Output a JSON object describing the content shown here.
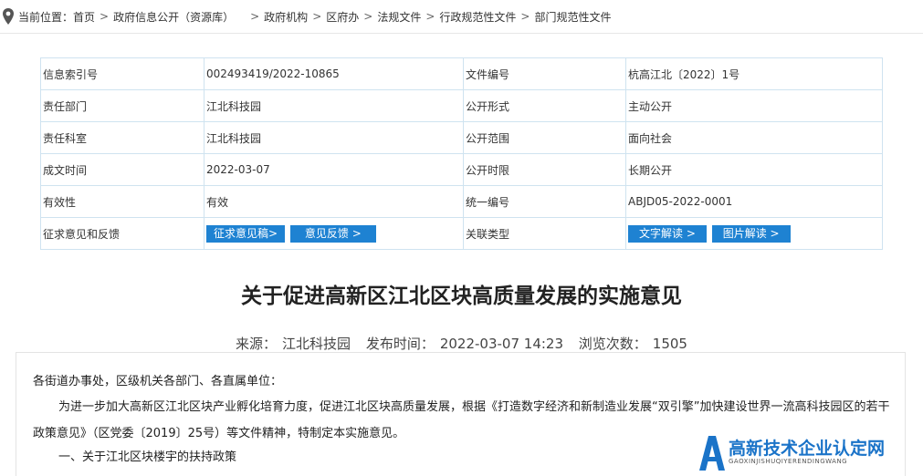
{
  "breadcrumb": {
    "label": "当前位置：",
    "items": [
      "首页",
      "政府信息公开（资源库）",
      "政府机构",
      "区府办",
      "法规文件",
      "行政规范性文件",
      "部门规范性文件"
    ]
  },
  "meta": {
    "rows": [
      {
        "k1": "信息索引号",
        "v1": "002493419/2022-10865",
        "k2": "文件编号",
        "v2": "杭高江北〔2022〕1号"
      },
      {
        "k1": "责任部门",
        "v1": "江北科技园",
        "k2": "公开形式",
        "v2": "主动公开"
      },
      {
        "k1": "责任科室",
        "v1": "江北科技园",
        "k2": "公开范围",
        "v2": "面向社会"
      },
      {
        "k1": "成文时间",
        "v1": "2022-03-07",
        "k2": "公开时限",
        "v2": "长期公开"
      },
      {
        "k1": "有效性",
        "v1": "有效",
        "k2": "统一编号",
        "v2": "ABJD05-2022-0001"
      }
    ],
    "feedback": {
      "k1": "征求意见和反馈",
      "btn_draft": "征求意见稿>",
      "btn_feedback": "意见反馈 >",
      "k2": "关联类型",
      "btn_text": "文字解读 >",
      "btn_image": "图片解读 >"
    }
  },
  "article": {
    "title": "关于促进高新区江北区块高质量发展的实施意见",
    "source_label": "来源：",
    "source": "江北科技园",
    "published_label": "发布时间：",
    "published": "2022-03-07 14:23",
    "views_label": "浏览次数：",
    "views": "1505",
    "p0": "各街道办事处，区级机关各部门、各直属单位：",
    "p1": "为进一步加大高新区江北区块产业孵化培育力度，促进江北区块高质量发展，根据《打造数字经济和新制造业发展“双引擎”加快建设世界一流高科技园区的若干政策意见》（区党委〔2019〕25号）等文件精神，特制定本实施意见。",
    "p2": "一、关于江北区块楼宇的扶持政策"
  },
  "watermark": {
    "big": "高新技术企业认定网",
    "small": "GAOXINJISHUQIYERENDINGWANG"
  },
  "colors": {
    "button": "#1e82d2",
    "border": "#cfe3f0",
    "watermark": "#1a73c8"
  },
  "icons": [
    "location-pin-icon"
  ]
}
